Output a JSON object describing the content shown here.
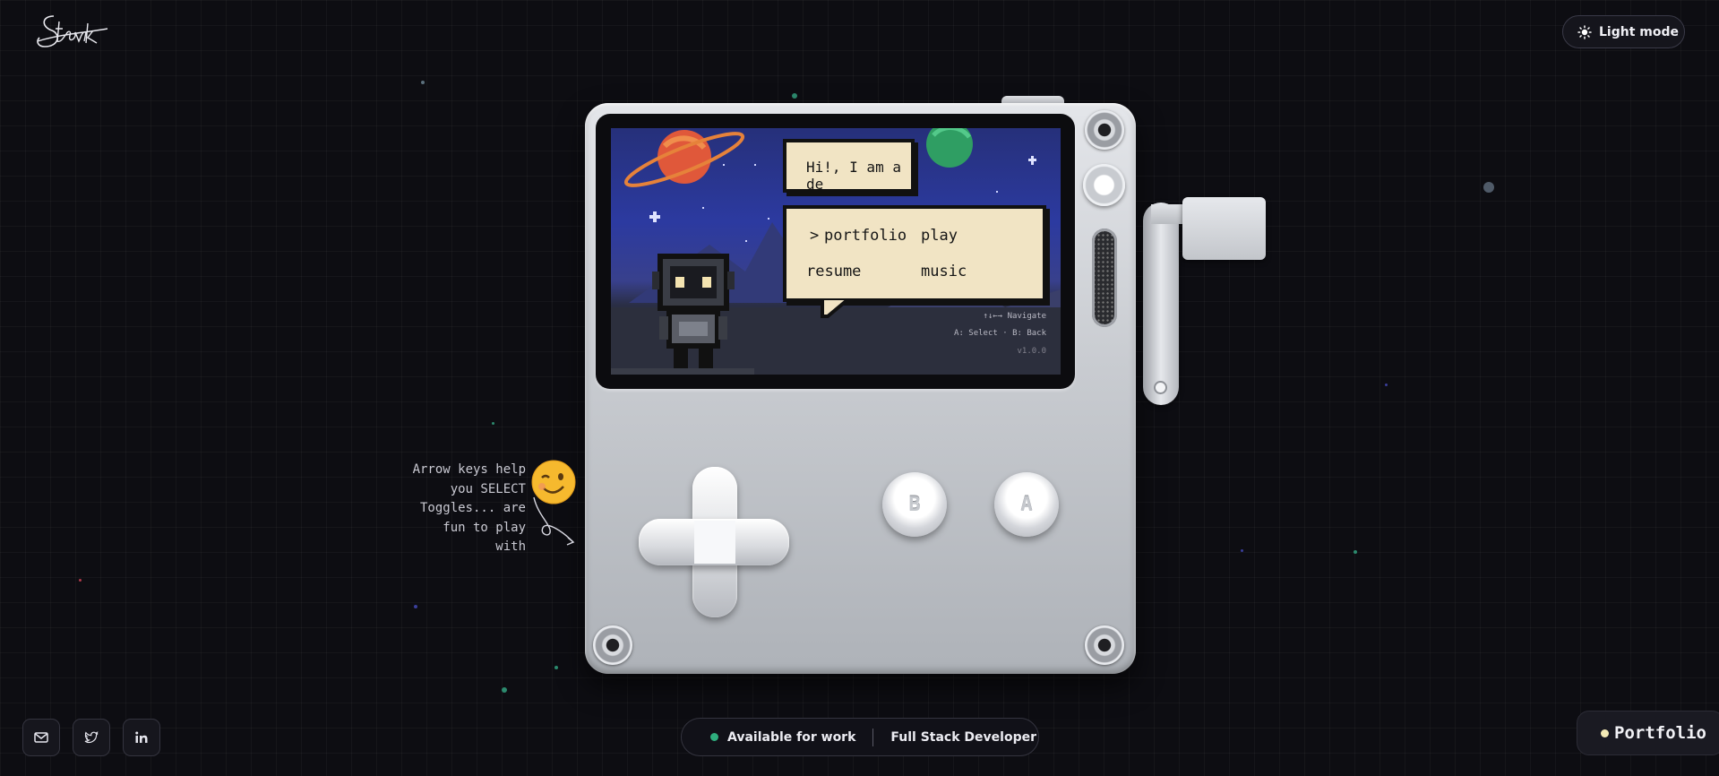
{
  "header": {
    "logo_text": "Stank",
    "theme_toggle_label": "Light mode",
    "theme_icon": "sun-icon"
  },
  "device": {
    "screen": {
      "greeting": "Hi!, I am a de",
      "menu": {
        "pointer": ">",
        "items": [
          "portfolio",
          "play",
          "resume",
          "music"
        ]
      },
      "hints": {
        "navigate": "↑↓←→ Navigate",
        "select_back": "A: Select · B: Back",
        "version": "v1.0.0"
      }
    },
    "buttons": {
      "b_label": "B",
      "a_label": "A"
    }
  },
  "side_hint": {
    "lines": [
      "Arrow keys help",
      "you SELECT",
      "Toggles... are",
      "fun to play with"
    ],
    "emoji": "winking-face"
  },
  "footer": {
    "social": [
      {
        "name": "mail-icon"
      },
      {
        "name": "twitter-icon"
      },
      {
        "name": "linkedin-icon"
      }
    ],
    "status": {
      "available": "Available for work",
      "role": "Full Stack Developer",
      "dot_color": "#2fae7e"
    },
    "portfolio_button": "Portfolio"
  }
}
